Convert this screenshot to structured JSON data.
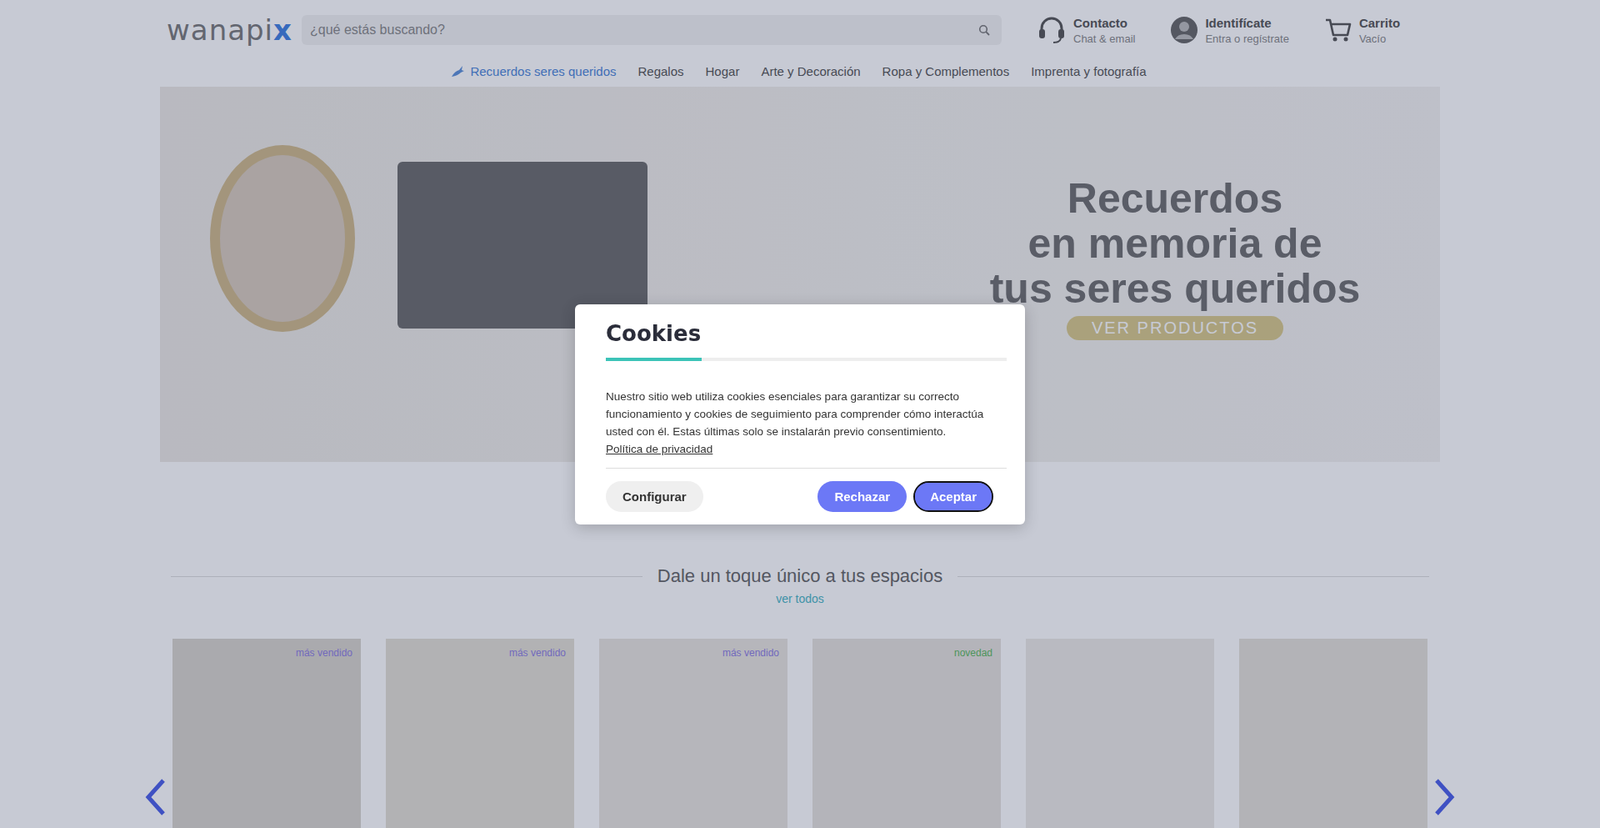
{
  "header": {
    "logo": {
      "text": "wanapi",
      "accent": "x"
    },
    "search": {
      "placeholder": "¿qué estás buscando?"
    },
    "contact": {
      "title": "Contacto",
      "subtitle": "Chat & email"
    },
    "account": {
      "title": "Identifícate",
      "subtitle": "Entra o regístrate"
    },
    "cart": {
      "title": "Carrito",
      "subtitle": "Vacío"
    }
  },
  "nav": [
    {
      "label": "Recuerdos seres queridos",
      "selected": true
    },
    {
      "label": "Regalos",
      "selected": false
    },
    {
      "label": "Hogar",
      "selected": false
    },
    {
      "label": "Arte y Decoración",
      "selected": false
    },
    {
      "label": "Ropa y Complementos",
      "selected": false
    },
    {
      "label": "Imprenta y fotografía",
      "selected": false
    }
  ],
  "hero": {
    "lines": [
      "Recuerdos",
      "en memoria de",
      "tus seres queridos"
    ],
    "button": "VER PRODUCTOS"
  },
  "section": {
    "title": "Dale un toque único a tus espacios",
    "link": "ver todos"
  },
  "products": [
    {
      "badge": "más vendido",
      "color": "#8d7ee0"
    },
    {
      "badge": "más vendido",
      "color": "#8d7ee0"
    },
    {
      "badge": "más vendido",
      "color": "#8d7ee0"
    },
    {
      "badge": "novedad",
      "color": "#5cb85c"
    },
    {},
    {}
  ],
  "cookies": {
    "title": "Cookies",
    "progress": 0.24,
    "text": "Nuestro sitio web utiliza cookies esenciales para garantizar su correcto funcionamiento y cookies de seguimiento para comprender cómo interactúa usted con él. Estas últimas solo se instalarán previo consentimiento.",
    "link": "Política de privacidad",
    "buttons": [
      {
        "label": "Configurar",
        "kind": "secondary",
        "focused": false
      },
      {
        "label": "Rechazar",
        "kind": "primary",
        "focused": false
      },
      {
        "label": "Aceptar",
        "kind": "primary",
        "focused": true
      }
    ]
  }
}
